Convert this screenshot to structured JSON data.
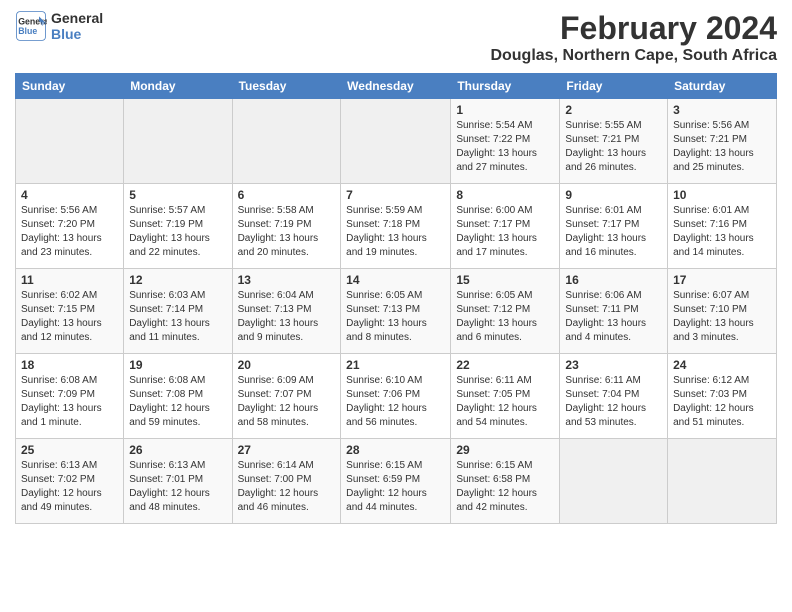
{
  "header": {
    "logo_line1": "General",
    "logo_line2": "Blue",
    "month_title": "February 2024",
    "location": "Douglas, Northern Cape, South Africa"
  },
  "weekdays": [
    "Sunday",
    "Monday",
    "Tuesday",
    "Wednesday",
    "Thursday",
    "Friday",
    "Saturday"
  ],
  "weeks": [
    [
      {
        "day": "",
        "info": ""
      },
      {
        "day": "",
        "info": ""
      },
      {
        "day": "",
        "info": ""
      },
      {
        "day": "",
        "info": ""
      },
      {
        "day": "1",
        "info": "Sunrise: 5:54 AM\nSunset: 7:22 PM\nDaylight: 13 hours\nand 27 minutes."
      },
      {
        "day": "2",
        "info": "Sunrise: 5:55 AM\nSunset: 7:21 PM\nDaylight: 13 hours\nand 26 minutes."
      },
      {
        "day": "3",
        "info": "Sunrise: 5:56 AM\nSunset: 7:21 PM\nDaylight: 13 hours\nand 25 minutes."
      }
    ],
    [
      {
        "day": "4",
        "info": "Sunrise: 5:56 AM\nSunset: 7:20 PM\nDaylight: 13 hours\nand 23 minutes."
      },
      {
        "day": "5",
        "info": "Sunrise: 5:57 AM\nSunset: 7:19 PM\nDaylight: 13 hours\nand 22 minutes."
      },
      {
        "day": "6",
        "info": "Sunrise: 5:58 AM\nSunset: 7:19 PM\nDaylight: 13 hours\nand 20 minutes."
      },
      {
        "day": "7",
        "info": "Sunrise: 5:59 AM\nSunset: 7:18 PM\nDaylight: 13 hours\nand 19 minutes."
      },
      {
        "day": "8",
        "info": "Sunrise: 6:00 AM\nSunset: 7:17 PM\nDaylight: 13 hours\nand 17 minutes."
      },
      {
        "day": "9",
        "info": "Sunrise: 6:01 AM\nSunset: 7:17 PM\nDaylight: 13 hours\nand 16 minutes."
      },
      {
        "day": "10",
        "info": "Sunrise: 6:01 AM\nSunset: 7:16 PM\nDaylight: 13 hours\nand 14 minutes."
      }
    ],
    [
      {
        "day": "11",
        "info": "Sunrise: 6:02 AM\nSunset: 7:15 PM\nDaylight: 13 hours\nand 12 minutes."
      },
      {
        "day": "12",
        "info": "Sunrise: 6:03 AM\nSunset: 7:14 PM\nDaylight: 13 hours\nand 11 minutes."
      },
      {
        "day": "13",
        "info": "Sunrise: 6:04 AM\nSunset: 7:13 PM\nDaylight: 13 hours\nand 9 minutes."
      },
      {
        "day": "14",
        "info": "Sunrise: 6:05 AM\nSunset: 7:13 PM\nDaylight: 13 hours\nand 8 minutes."
      },
      {
        "day": "15",
        "info": "Sunrise: 6:05 AM\nSunset: 7:12 PM\nDaylight: 13 hours\nand 6 minutes."
      },
      {
        "day": "16",
        "info": "Sunrise: 6:06 AM\nSunset: 7:11 PM\nDaylight: 13 hours\nand 4 minutes."
      },
      {
        "day": "17",
        "info": "Sunrise: 6:07 AM\nSunset: 7:10 PM\nDaylight: 13 hours\nand 3 minutes."
      }
    ],
    [
      {
        "day": "18",
        "info": "Sunrise: 6:08 AM\nSunset: 7:09 PM\nDaylight: 13 hours\nand 1 minute."
      },
      {
        "day": "19",
        "info": "Sunrise: 6:08 AM\nSunset: 7:08 PM\nDaylight: 12 hours\nand 59 minutes."
      },
      {
        "day": "20",
        "info": "Sunrise: 6:09 AM\nSunset: 7:07 PM\nDaylight: 12 hours\nand 58 minutes."
      },
      {
        "day": "21",
        "info": "Sunrise: 6:10 AM\nSunset: 7:06 PM\nDaylight: 12 hours\nand 56 minutes."
      },
      {
        "day": "22",
        "info": "Sunrise: 6:11 AM\nSunset: 7:05 PM\nDaylight: 12 hours\nand 54 minutes."
      },
      {
        "day": "23",
        "info": "Sunrise: 6:11 AM\nSunset: 7:04 PM\nDaylight: 12 hours\nand 53 minutes."
      },
      {
        "day": "24",
        "info": "Sunrise: 6:12 AM\nSunset: 7:03 PM\nDaylight: 12 hours\nand 51 minutes."
      }
    ],
    [
      {
        "day": "25",
        "info": "Sunrise: 6:13 AM\nSunset: 7:02 PM\nDaylight: 12 hours\nand 49 minutes."
      },
      {
        "day": "26",
        "info": "Sunrise: 6:13 AM\nSunset: 7:01 PM\nDaylight: 12 hours\nand 48 minutes."
      },
      {
        "day": "27",
        "info": "Sunrise: 6:14 AM\nSunset: 7:00 PM\nDaylight: 12 hours\nand 46 minutes."
      },
      {
        "day": "28",
        "info": "Sunrise: 6:15 AM\nSunset: 6:59 PM\nDaylight: 12 hours\nand 44 minutes."
      },
      {
        "day": "29",
        "info": "Sunrise: 6:15 AM\nSunset: 6:58 PM\nDaylight: 12 hours\nand 42 minutes."
      },
      {
        "day": "",
        "info": ""
      },
      {
        "day": "",
        "info": ""
      }
    ]
  ]
}
